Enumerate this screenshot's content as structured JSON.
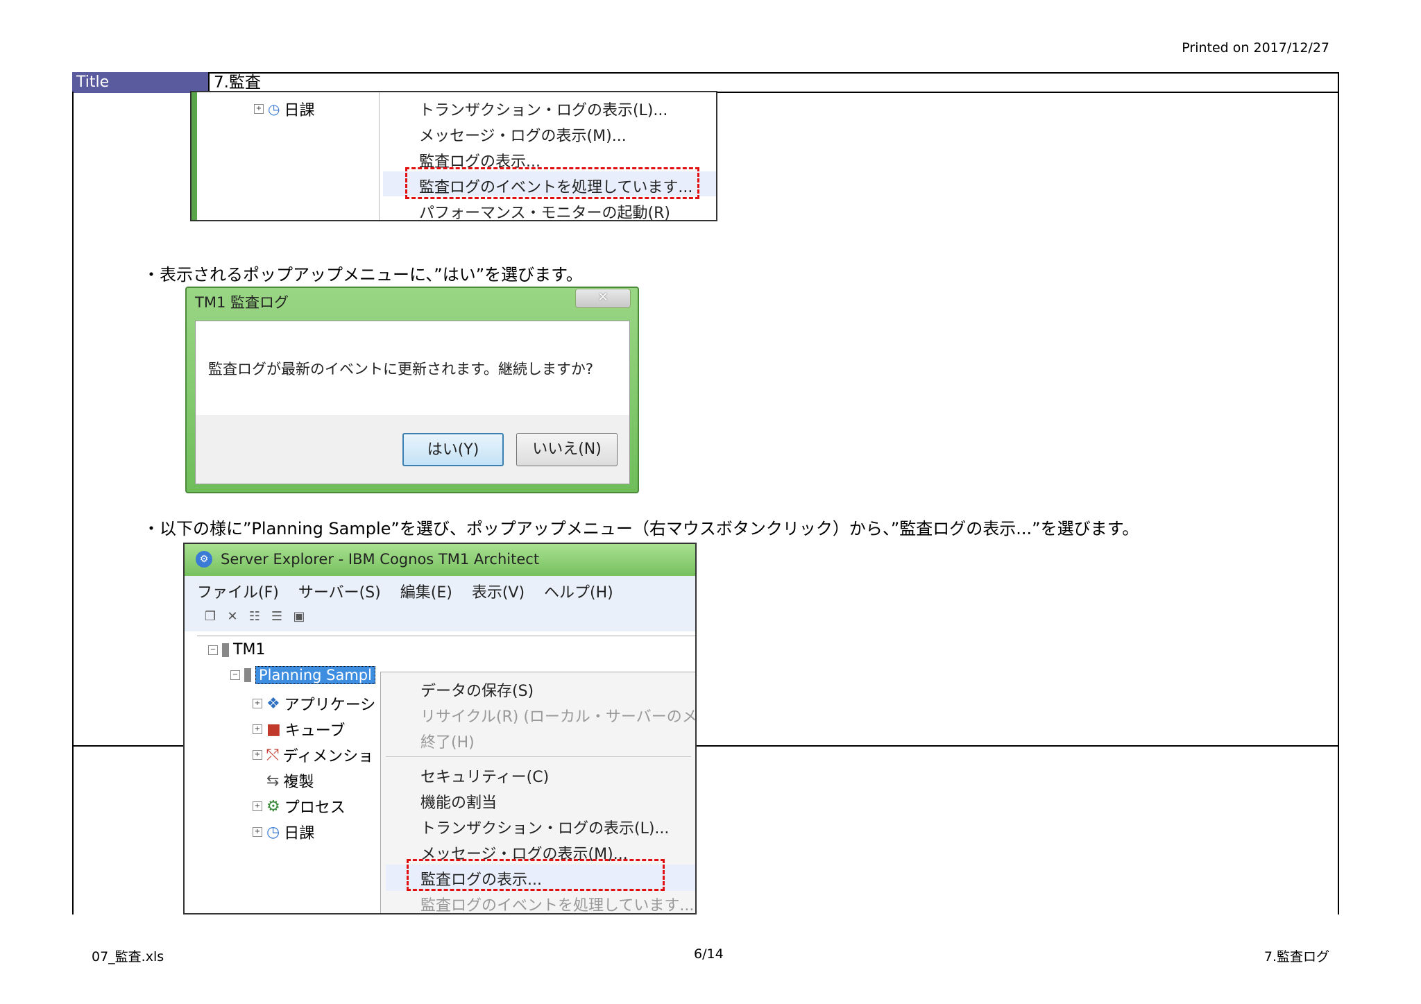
{
  "header": {
    "printed_on": "Printed on 2017/12/27"
  },
  "title_row": {
    "label": "Title",
    "value": "7.監査"
  },
  "screenshot1": {
    "tree_item": "日課",
    "menu": [
      "トランザクション・ログの表示(L)...",
      "メッセージ・ログの表示(M)...",
      "監査ログの表示...",
      "監査ログのイベントを処理しています...",
      "パフォーマンス・モニターの起動(R)"
    ]
  },
  "note1": "・表示されるポップアップメニューに、”はい”を選びます。",
  "dialog": {
    "title": "TM1 監査ログ",
    "close": "✕",
    "message": "監査ログが最新のイベントに更新されます。継続しますか?",
    "yes": "はい(Y)",
    "no": "いいえ(N)"
  },
  "note2": "・以下の様に”Planning Sample”を選び、ポップアップメニュー（右マウスボタンクリック）から、”監査ログの表示...”を選びます。",
  "screenshot2": {
    "window_title": "Server Explorer - IBM Cognos TM1 Architect",
    "menubar": [
      "ファイル(F)",
      "サーバー(S)",
      "編集(E)",
      "表示(V)",
      "ヘルプ(H)"
    ],
    "tree_root": "TM1",
    "tree_selected": "Planning Sampl",
    "tree_children": [
      "アプリケーシ",
      "キューブ",
      "ディメンショ",
      "複製",
      "プロセス",
      "日課"
    ],
    "menu_group1": [
      "データの保存(S)",
      "リサイクル(R) (ローカル・サーバーのメモ",
      "終了(H)"
    ],
    "menu_group2": [
      "セキュリティー(C)",
      "機能の割当",
      "トランザクション・ログの表示(L)...",
      "メッセージ・ログの表示(M)...",
      "監査ログの表示...",
      "監査ログのイベントを処理しています..."
    ]
  },
  "footer": {
    "file": "07_監査.xls",
    "page": "6/14",
    "sheet": "7.監査ログ"
  },
  "colors": {
    "title_bg": "#5a5a9e",
    "highlight": "#e01010",
    "window_green": "#76c15f"
  }
}
